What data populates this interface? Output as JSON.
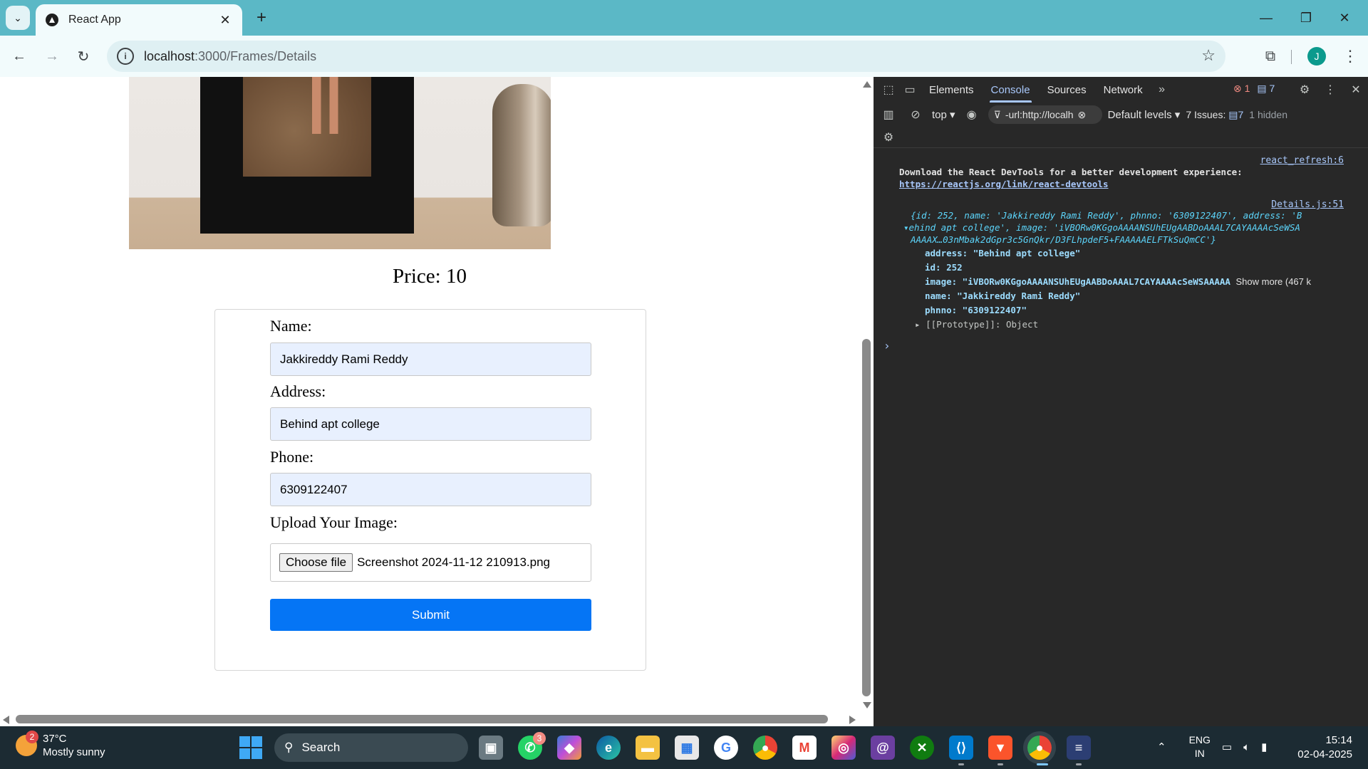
{
  "browser": {
    "tab_title": "React App",
    "url_host": "localhost",
    "url_path": ":3000/Frames/Details"
  },
  "page": {
    "price_label": "Price: 10",
    "form": {
      "name_label": "Name:",
      "name_value": "Jakkireddy Rami Reddy",
      "address_label": "Address:",
      "address_value": "Behind apt college",
      "phone_label": "Phone:",
      "phone_value": "6309122407",
      "upload_label": "Upload Your Image:",
      "choose_file_label": "Choose file",
      "file_name": "Screenshot 2024-11-12 210913.png",
      "submit_label": "Submit"
    }
  },
  "devtools": {
    "tabs": [
      "Elements",
      "Console",
      "Sources",
      "Network"
    ],
    "active_tab": "Console",
    "error_count": "1",
    "message_count": "7",
    "context": "top",
    "filter_value": "-url:http://localh",
    "levels": "Default levels",
    "issues_label": "7 Issues:",
    "issues_count": "7",
    "hidden": "1 hidden",
    "console": {
      "src1": "react_refresh:6",
      "line1": "Download the React DevTools for a better development experience:",
      "link1": "https://reactjs.org/link/react-devtools",
      "src2": "Details.js:51",
      "obj_preview_1a": "{id: 252, name: 'Jakkireddy Rami Reddy', phnno: '6309122407', address: 'B",
      "obj_preview_1b": "ehind apt college', image: 'iVBORw0KGgoAAAANSUhEUgAABDoAAAL7CAYAAAAcSeWSA",
      "obj_preview_1c": "AAAAX…03nMbak2dGpr3c5GnQkr/D3FLhpdeF5+FAAAAAELFTkSuQmCC'}",
      "prop_address": "address: \"Behind apt college\"",
      "prop_id": "id: 252",
      "prop_image": "image: \"iVBORw0KGgoAAAANSUhEUgAABDoAAAL7CAYAAAAcSeWSAAAAA",
      "show_more": "Show more (467 k",
      "prop_name": "name: \"Jakkireddy Rami Reddy\"",
      "prop_phnno": "phnno: \"6309122407\"",
      "prop_proto": "[[Prototype]]: Object"
    }
  },
  "taskbar": {
    "weather_temp": "37°C",
    "weather_desc": "Mostly sunny",
    "weather_badge": "2",
    "search_label": "Search",
    "whatsapp_badge": "3",
    "lang_top": "ENG",
    "lang_bottom": "IN",
    "time": "15:14",
    "date": "02-04-2025"
  },
  "colors": {
    "chrome_frame": "#5bb8c6",
    "submit_blue": "#0575f5",
    "devtools_bg": "#282828"
  }
}
